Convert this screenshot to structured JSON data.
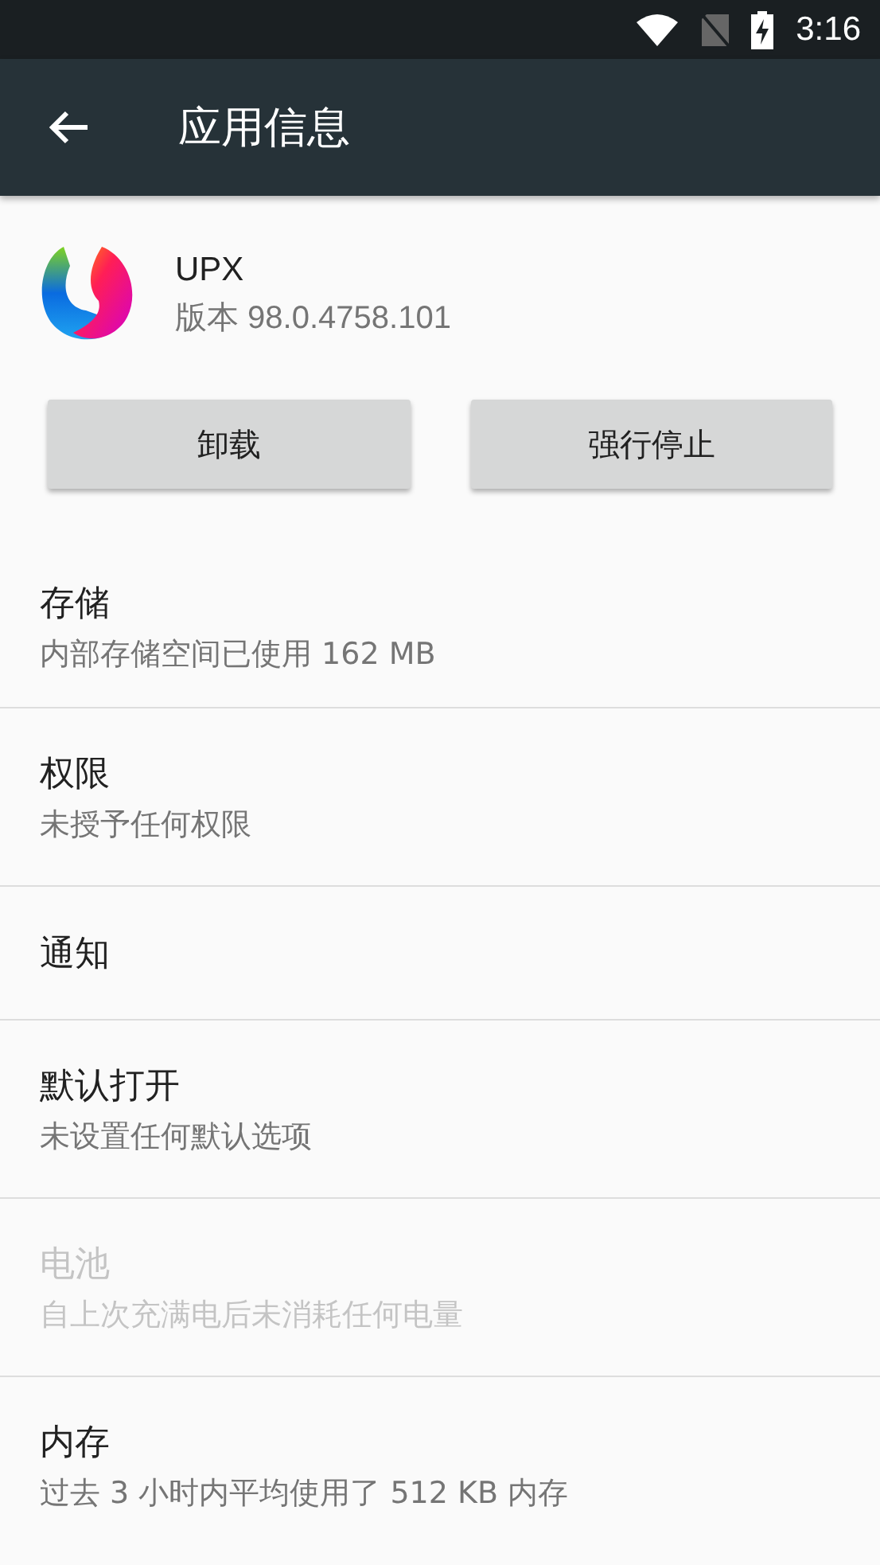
{
  "status_bar": {
    "time": "3:16"
  },
  "app_bar": {
    "title": "应用信息"
  },
  "app": {
    "name": "UPX",
    "version": "版本 98.0.4758.101"
  },
  "buttons": [
    "卸载",
    "强行停止"
  ],
  "items": [
    {
      "title": "存储",
      "subtitle": "内部存储空间已使用 162 MB",
      "disabled": false
    },
    {
      "title": "权限",
      "subtitle": "未授予任何权限",
      "disabled": false
    },
    {
      "title": "通知",
      "disabled": false
    },
    {
      "title": "默认打开",
      "subtitle": "未设置任何默认选项",
      "disabled": false
    },
    {
      "title": "电池",
      "subtitle": "自上次充满电后未消耗任何电量",
      "disabled": true
    },
    {
      "title": "内存",
      "subtitle": "过去 3 小时内平均使用了 512 KB 内存",
      "disabled": false
    }
  ]
}
